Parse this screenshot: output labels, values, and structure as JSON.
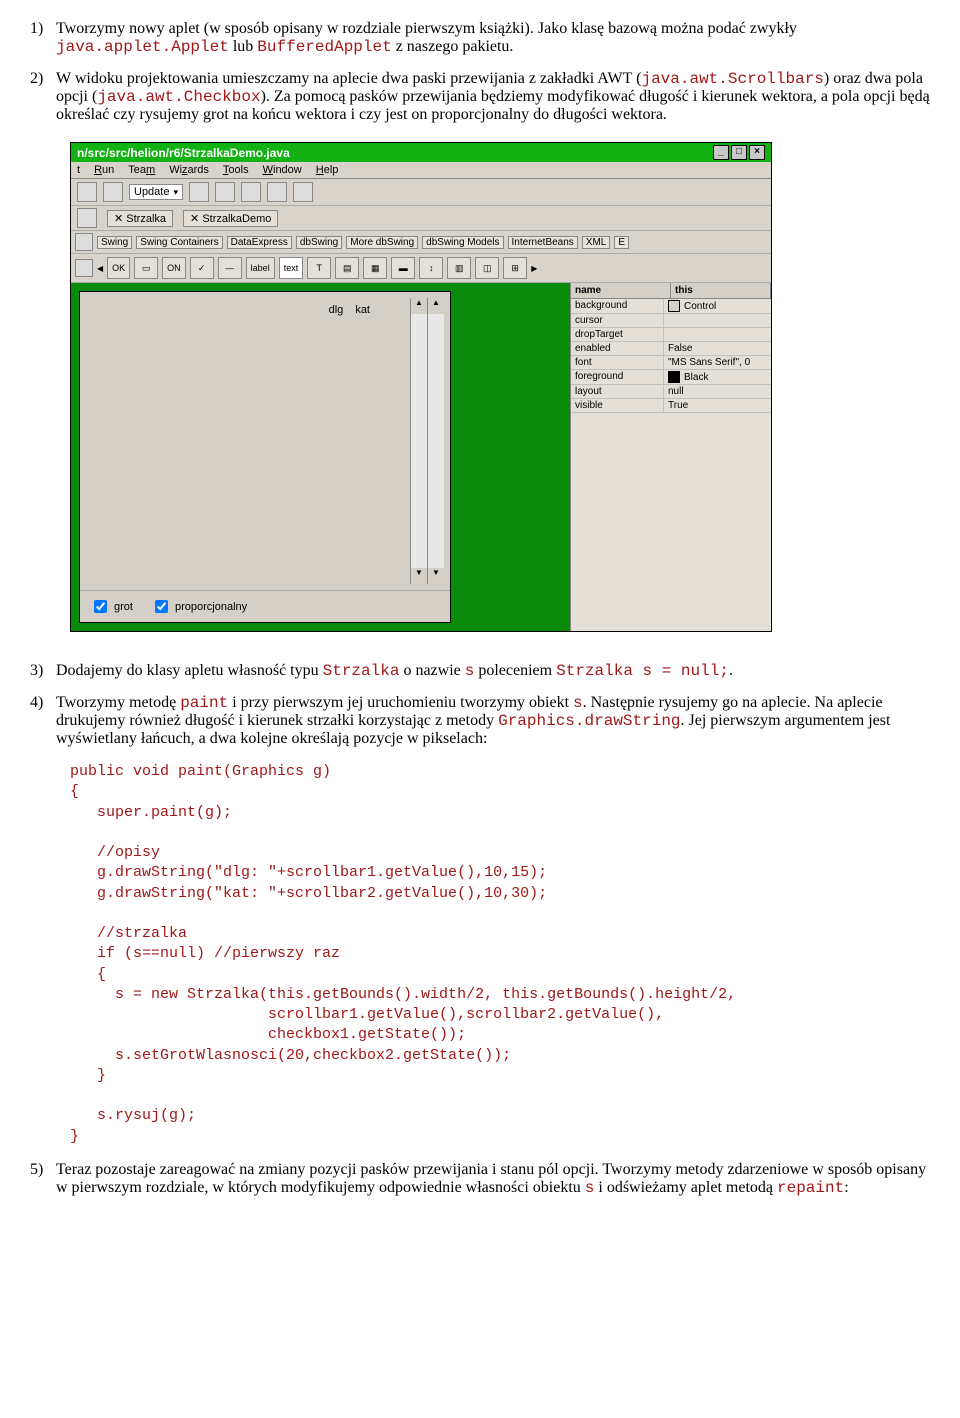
{
  "items": {
    "p1": {
      "num": "1)",
      "t1": "Tworzymy nowy aplet (w sposób opisany w rozdziale pierwszym książki). Jako klasę bazową można podać zwykły ",
      "c1": "java.applet.Applet",
      "t2": " lub ",
      "c2": "BufferedApplet",
      "t3": " z naszego pakietu."
    },
    "p2": {
      "num": "2)",
      "t1": "W widoku projektowania umieszczamy na aplecie dwa paski przewijania z zakładki AWT (",
      "c1": "java.awt.Scrollbars",
      "t2": ") oraz dwa pola opcji (",
      "c2": "java.awt.Checkbox",
      "t3": "). Za pomocą pasków przewijania będziemy modyfikować długość i kierunek wektora, a pola opcji będą określać czy rysujemy grot na końcu wektora i czy jest on proporcjonalny do długości wektora."
    },
    "p3": {
      "num": "3)",
      "t1": "Dodajemy do klasy apletu własność typu ",
      "c1": "Strzalka",
      "t2": " o nazwie ",
      "c2": "s",
      "t3": " poleceniem ",
      "c3": "Strzalka s = null;",
      "t4": "."
    },
    "p4": {
      "num": "4)",
      "t1": "Tworzymy metodę ",
      "c1": "paint",
      "t2": " i przy pierwszym jej uruchomieniu tworzymy obiekt ",
      "c2": "s",
      "t3": ". Następnie rysujemy go na aplecie. Na aplecie drukujemy również długość i kierunek strzałki korzystając z metody ",
      "c3": "Graphics.drawString",
      "t4": ". Jej pierwszym argumentem jest wyświetlany łańcuch, a dwa kolejne określają pozycje w pikselach:"
    },
    "p5": {
      "num": "5)",
      "t1": "Teraz pozostaje zareagować na zmiany pozycji pasków przewijania i stanu pól opcji. Tworzymy metody zdarzeniowe w sposób opisany w pierwszym rozdziale, w których modyfikujemy odpowiednie własności obiektu ",
      "c1": "s",
      "t2": " i odświeżamy aplet metodą ",
      "c2": "repaint",
      "t3": ":"
    }
  },
  "code1": "public void paint(Graphics g)\n{\n   super.paint(g);\n\n   //opisy\n   g.drawString(\"dlg: \"+scrollbar1.getValue(),10,15);\n   g.drawString(\"kat: \"+scrollbar2.getValue(),10,30);\n\n   //strzalka\n   if (s==null) //pierwszy raz\n   {\n     s = new Strzalka(this.getBounds().width/2, this.getBounds().height/2,\n                      scrollbar1.getValue(),scrollbar2.getValue(),\n                      checkbox1.getState());\n     s.setGrotWlasnosci(20,checkbox2.getState());\n   }\n\n   s.rysuj(g);\n}",
  "shot": {
    "title": "n/src/src/helion/r6/StrzalkaDemo.java",
    "menus": [
      "t",
      "Run",
      "Team",
      "Wizards",
      "Tools",
      "Window",
      "Help"
    ],
    "toolbar_update": "Update",
    "tabs": [
      "Strzalka",
      "StrzalkaDemo"
    ],
    "palette_tabs": [
      "Swing",
      "Swing Containers",
      "DataExpress",
      "dbSwing",
      "More dbSwing",
      "dbSwing Models",
      "InternetBeans",
      "XML",
      "E"
    ],
    "pal_items": [
      "OK",
      "ON",
      "✓",
      "label",
      "text",
      "T"
    ],
    "form_labels": {
      "a": "dlg",
      "b": "kat"
    },
    "checkboxes": {
      "a": "grot",
      "b": "proporcjonalny"
    },
    "prop_headers": {
      "a": "name",
      "b": "this"
    },
    "props": [
      {
        "n": "background",
        "v": "Control",
        "sw": "#d4d0c8"
      },
      {
        "n": "cursor",
        "v": ""
      },
      {
        "n": "dropTarget",
        "v": ""
      },
      {
        "n": "enabled",
        "v": "False"
      },
      {
        "n": "font",
        "v": "\"MS Sans Serif\", 0"
      },
      {
        "n": "foreground",
        "v": "Black",
        "sw": "#000000"
      },
      {
        "n": "layout",
        "v": "null"
      },
      {
        "n": "visible",
        "v": "True"
      }
    ]
  }
}
